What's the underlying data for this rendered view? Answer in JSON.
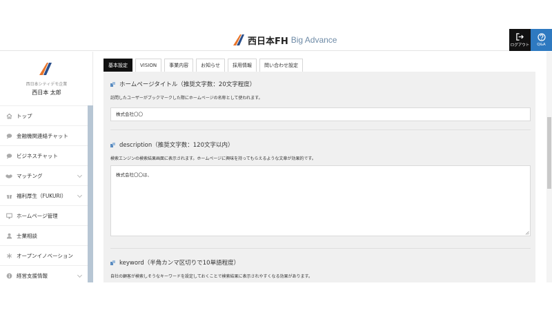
{
  "header": {
    "brand_name": "西日本FH",
    "brand_sub": "Big Advance",
    "logout_label": "ログアウト",
    "qa_label": "Q&A",
    "accent_color": "#2e79c0"
  },
  "sidebar": {
    "company": "西日本シティデモ企業",
    "user_name": "西日本 太郎",
    "items": [
      {
        "label": "トップ",
        "icon": "home-icon",
        "has_submenu": false
      },
      {
        "label": "金融機関連絡チャット",
        "icon": "chat-bubble-icon",
        "has_submenu": false
      },
      {
        "label": "ビジネスチャット",
        "icon": "chat-bubble-icon",
        "has_submenu": false
      },
      {
        "label": "マッチング",
        "icon": "handshake-icon",
        "has_submenu": true
      },
      {
        "label": "福利厚生（FUKURI）",
        "icon": "gift-icon",
        "has_submenu": true
      },
      {
        "label": "ホームページ管理",
        "icon": "monitor-icon",
        "has_submenu": false
      },
      {
        "label": "士業相談",
        "icon": "person-icon",
        "has_submenu": false
      },
      {
        "label": "オープンイノベーション",
        "icon": "asterisk-icon",
        "has_submenu": false
      },
      {
        "label": "経営支援情報",
        "icon": "info-icon",
        "has_submenu": true
      }
    ]
  },
  "tabs": [
    {
      "label": "基本設定",
      "active": true
    },
    {
      "label": "VISION",
      "active": false
    },
    {
      "label": "事業内容",
      "active": false
    },
    {
      "label": "お知らせ",
      "active": false
    },
    {
      "label": "採用情報",
      "active": false
    },
    {
      "label": "問い合わせ設定",
      "active": false
    }
  ],
  "sections": {
    "title": {
      "heading": "ホームページタイトル（推奨文字数：20文字程度）",
      "description": "訪問したユーザーがブックマークした際にホームページの名称として使われます。",
      "value": "株式会社〇〇"
    },
    "description": {
      "heading": "description（推奨文字数：120文字以内）",
      "description": "検索エンジンの検索結果画面に表示されます。ホームページに興味を持ってもらえるような文章が効果的です。",
      "value": "株式会社〇〇は、"
    },
    "keyword": {
      "heading": "keyword（半角カンマ区切りで10単語程度）",
      "description": "自社の顧客が検索しそうなキーワードを設定しておくことで検索結果に表示されやすくなる効果があります。"
    }
  }
}
